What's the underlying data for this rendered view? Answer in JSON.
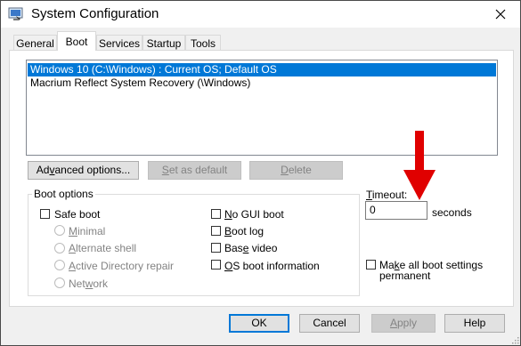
{
  "window": {
    "title": "System Configuration"
  },
  "tabs": [
    {
      "label": "General",
      "active": false
    },
    {
      "label": "Boot",
      "active": true
    },
    {
      "label": "Services",
      "active": false
    },
    {
      "label": "Startup",
      "active": false
    },
    {
      "label": "Tools",
      "active": false
    }
  ],
  "boot_entries": [
    {
      "text": "Windows 10 (C:\\Windows) : Current OS; Default OS",
      "selected": true
    },
    {
      "text": "Macrium Reflect System Recovery (\\Windows)",
      "selected": false
    }
  ],
  "entry_buttons": {
    "advanced": "Advanced options...",
    "set_default": "Set as default",
    "delete": "Delete"
  },
  "boot_options": {
    "label": "Boot options",
    "safe_boot": "Safe boot",
    "minimal": "Minimal",
    "alternate_shell": "Alternate shell",
    "ad_repair": "Active Directory repair",
    "network": "Network",
    "no_gui_boot": "No GUI boot",
    "boot_log": "Boot log",
    "base_video": "Base video",
    "os_boot_info": "OS boot information"
  },
  "timeout": {
    "label": "Timeout:",
    "value": "0",
    "unit": "seconds"
  },
  "make_permanent": {
    "line1": "Make all boot settings",
    "line2": "permanent"
  },
  "dialog_buttons": {
    "ok": "OK",
    "cancel": "Cancel",
    "apply": "Apply",
    "help": "Help"
  },
  "colors": {
    "selection": "#0078d7",
    "annotation_arrow": "#e00000"
  }
}
